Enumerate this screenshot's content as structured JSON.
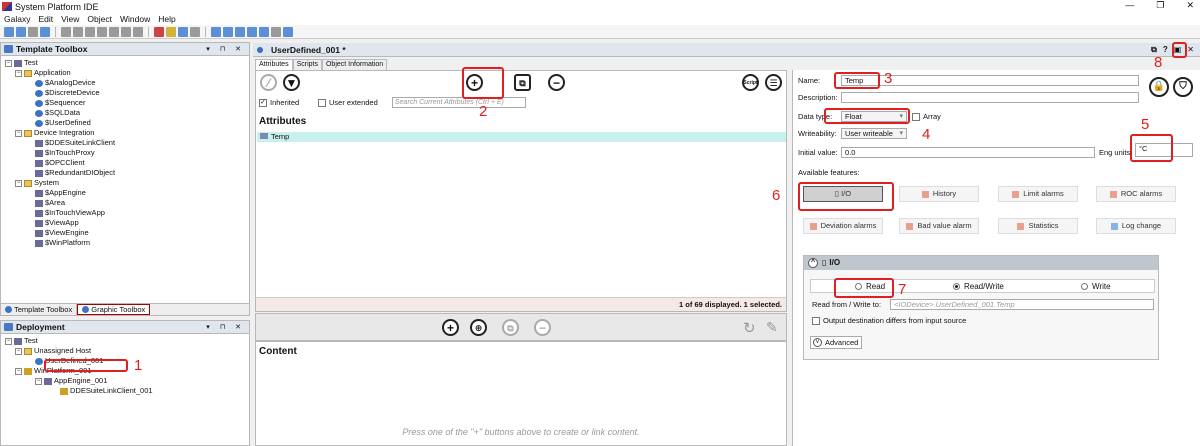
{
  "window": {
    "title": "System Platform IDE",
    "controls": [
      "—",
      "❐",
      "✕"
    ]
  },
  "menu": [
    "Galaxy",
    "Edit",
    "View",
    "Object",
    "Window",
    "Help"
  ],
  "template_toolbox": {
    "title": "Template Toolbox",
    "root": "Test",
    "groups": [
      {
        "name": "Application",
        "items": [
          "$AnalogDevice",
          "$DiscreteDevice",
          "$Sequencer",
          "$SQLData",
          "$UserDefined"
        ]
      },
      {
        "name": "Device Integration",
        "items": [
          "$DDESuiteLinkClient",
          "$InTouchProxy",
          "$OPCClient",
          "$RedundantDIObject"
        ]
      },
      {
        "name": "System",
        "items": [
          "$AppEngine",
          "$Area",
          "$InTouchViewApp",
          "$ViewApp",
          "$ViewEngine",
          "$WinPlatform"
        ]
      }
    ],
    "tabs": [
      "Template Toolbox",
      "Graphic Toolbox"
    ]
  },
  "deployment": {
    "title": "Deployment",
    "root": "Test",
    "unassigned": "Unassigned Host",
    "selected": "UserDefined_001",
    "platform": "WinPlatform_001",
    "engine": "AppEngine_001",
    "client": "DDESuiteLinkClient_001"
  },
  "editor": {
    "title": "UserDefined_001 *",
    "tabs": [
      "Attributes",
      "Scripts",
      "Object Information"
    ],
    "inherited_label": "Inherited",
    "user_extended_label": "User extended",
    "search_placeholder": "Search Current Attributes (Ctrl + E)",
    "attributes_title": "Attributes",
    "attribute_row": "Temp",
    "status": "1 of 69 displayed. 1 selected.",
    "content_title": "Content",
    "content_hint": "Press one of the \"+\" buttons above to create or link content.",
    "script_btn": "Script"
  },
  "props": {
    "name_label": "Name:",
    "name_value": "Temp",
    "description_label": "Description:",
    "datatype_label": "Data type:",
    "datatype_value": "Float",
    "array_label": "Array",
    "writeability_label": "Writeability:",
    "writeability_value": "User writeable",
    "initial_label": "Initial value:",
    "initial_value": "0.0",
    "eng_label": "Eng units:",
    "eng_value": "°C",
    "features_label": "Available features:",
    "features": [
      "I/O",
      "History",
      "Limit alarms",
      "ROC alarms",
      "Deviation alarms",
      "Bad value alarm",
      "Statistics",
      "Log change"
    ],
    "io_title": "I/O",
    "radio_read": "Read",
    "radio_readwrite": "Read/Write",
    "radio_write": "Write",
    "readfrom_label": "Read from / Write to:",
    "readfrom_value": "<IODevice>.UserDefined_001.Temp",
    "output_diff_label": "Output destination differs from input source",
    "advanced_label": "Advanced"
  },
  "annotations": [
    "1",
    "2",
    "3",
    "4",
    "5",
    "6",
    "7",
    "8"
  ]
}
